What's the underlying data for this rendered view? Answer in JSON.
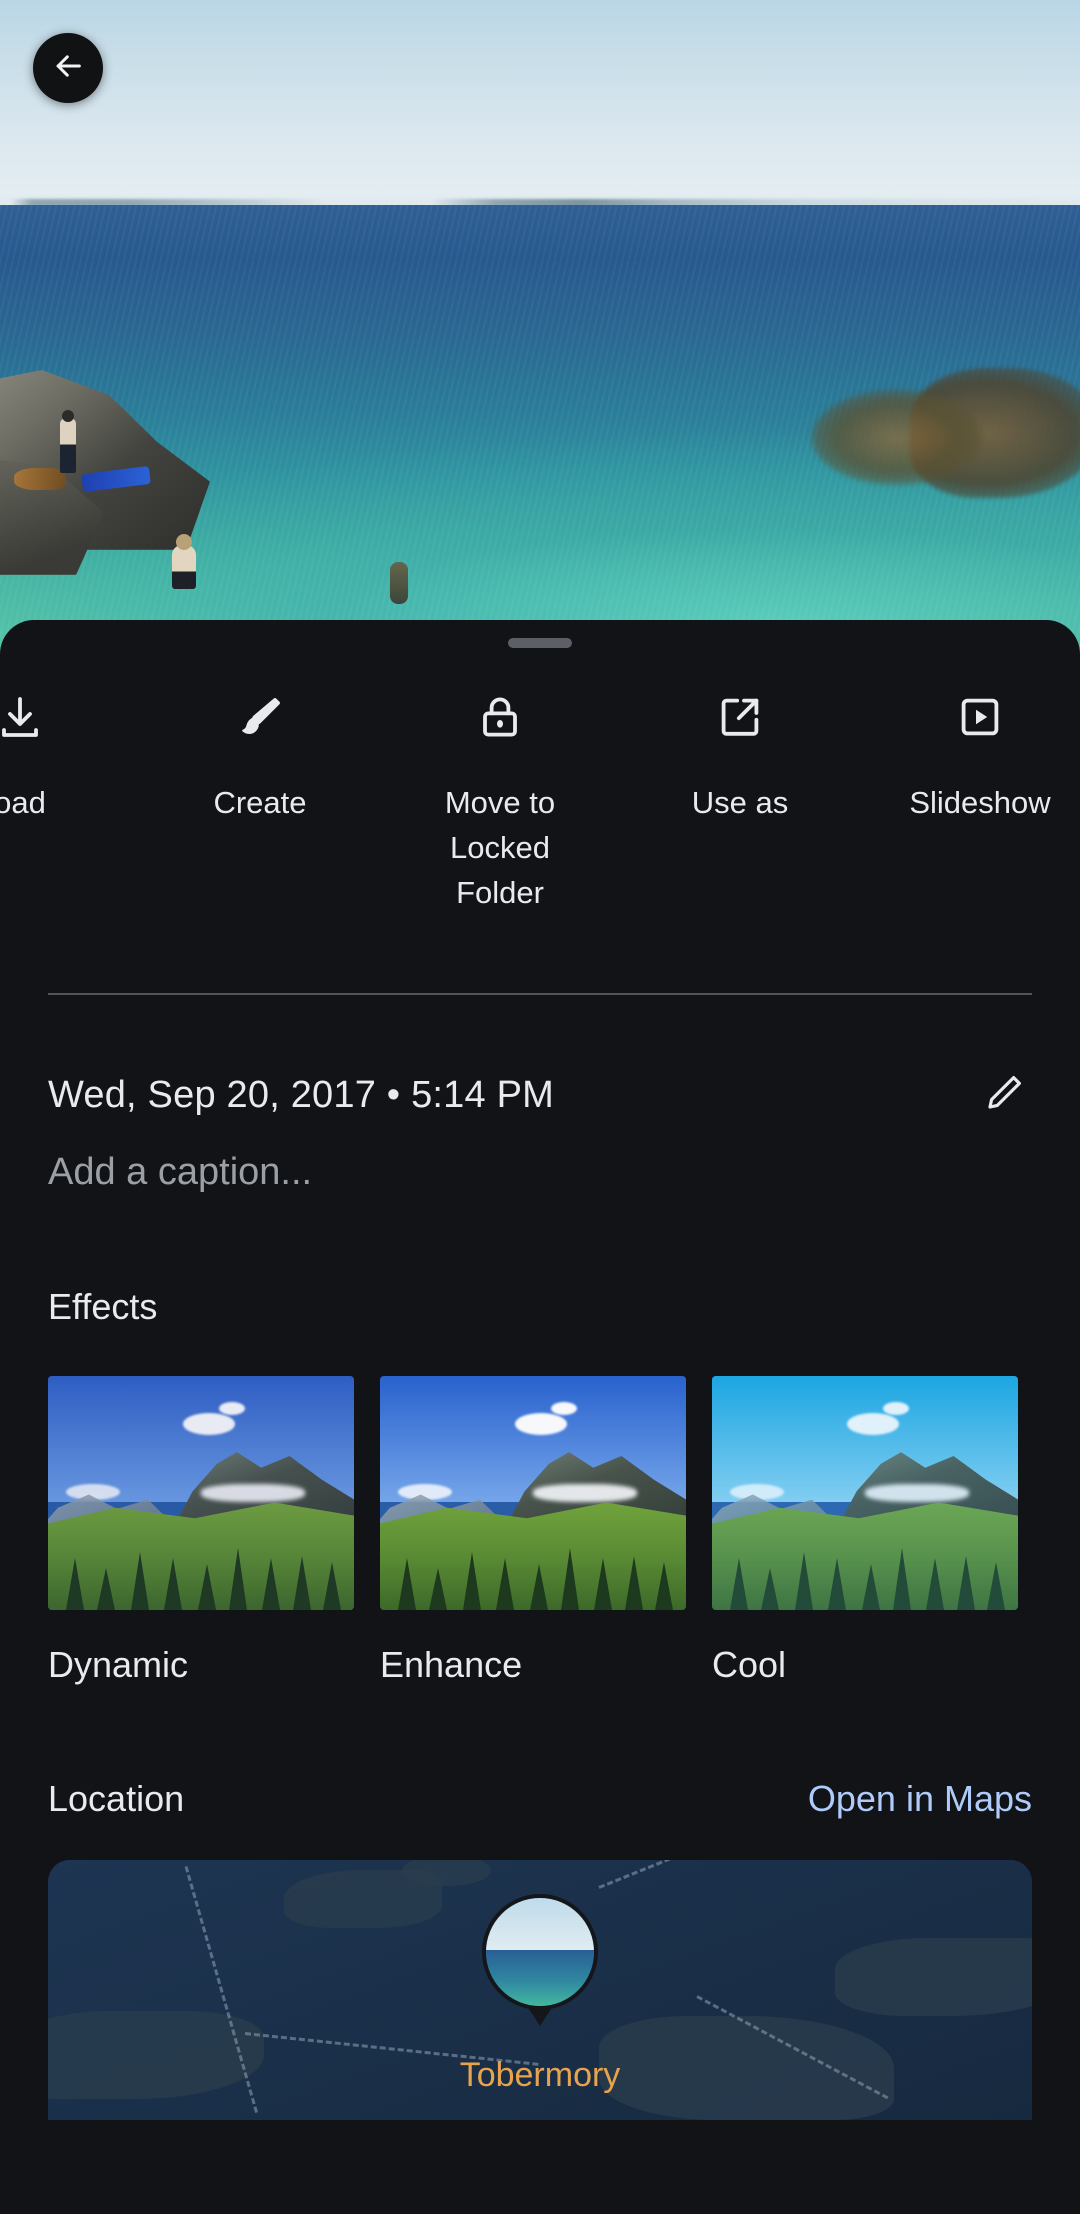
{
  "app": {
    "accent_blue": "#aecbfa",
    "sheet_bg": "#121317",
    "text_primary": "#e8eaed",
    "text_secondary": "#9aa0a6",
    "map_label_color": "#e8a44c"
  },
  "header": {
    "back_label": "Back",
    "back_icon": "arrow-back-icon"
  },
  "photo": {
    "alt": "Seascape with rocky shore and turquoise water"
  },
  "sheet": {
    "grabber": "drag-handle"
  },
  "actions": [
    {
      "label": "Download",
      "icon": "download-icon",
      "truncated": "oad"
    },
    {
      "label": "Create",
      "icon": "brush-icon"
    },
    {
      "label": "Move to Locked Folder",
      "icon": "lock-icon"
    },
    {
      "label": "Use as",
      "icon": "open-in-new-icon"
    },
    {
      "label": "Slideshow",
      "icon": "slideshow-play-icon"
    }
  ],
  "details": {
    "date_time": "Wed, Sep 20, 2017  •  5:14 PM",
    "edit_icon": "pencil-edit-icon",
    "caption_placeholder": "Add a caption..."
  },
  "effects": {
    "title": "Effects",
    "items": [
      {
        "label": "Dynamic",
        "overlay": "rgba(40,60,150,0.10)",
        "sky_top": "#2f62c8",
        "sky_bottom": "#6fa0e8"
      },
      {
        "label": "Enhance",
        "overlay": "rgba(30,80,180,0.04)",
        "sky_top": "#2a63cf",
        "sky_bottom": "#79a9ec"
      },
      {
        "label": "Cool",
        "overlay": "rgba(60,170,235,0.16)",
        "sky_top": "#16a6e0",
        "sky_bottom": "#8fd5f2"
      }
    ]
  },
  "location": {
    "title": "Location",
    "open_in_maps": "Open in Maps",
    "place_label": "Tobermory"
  }
}
